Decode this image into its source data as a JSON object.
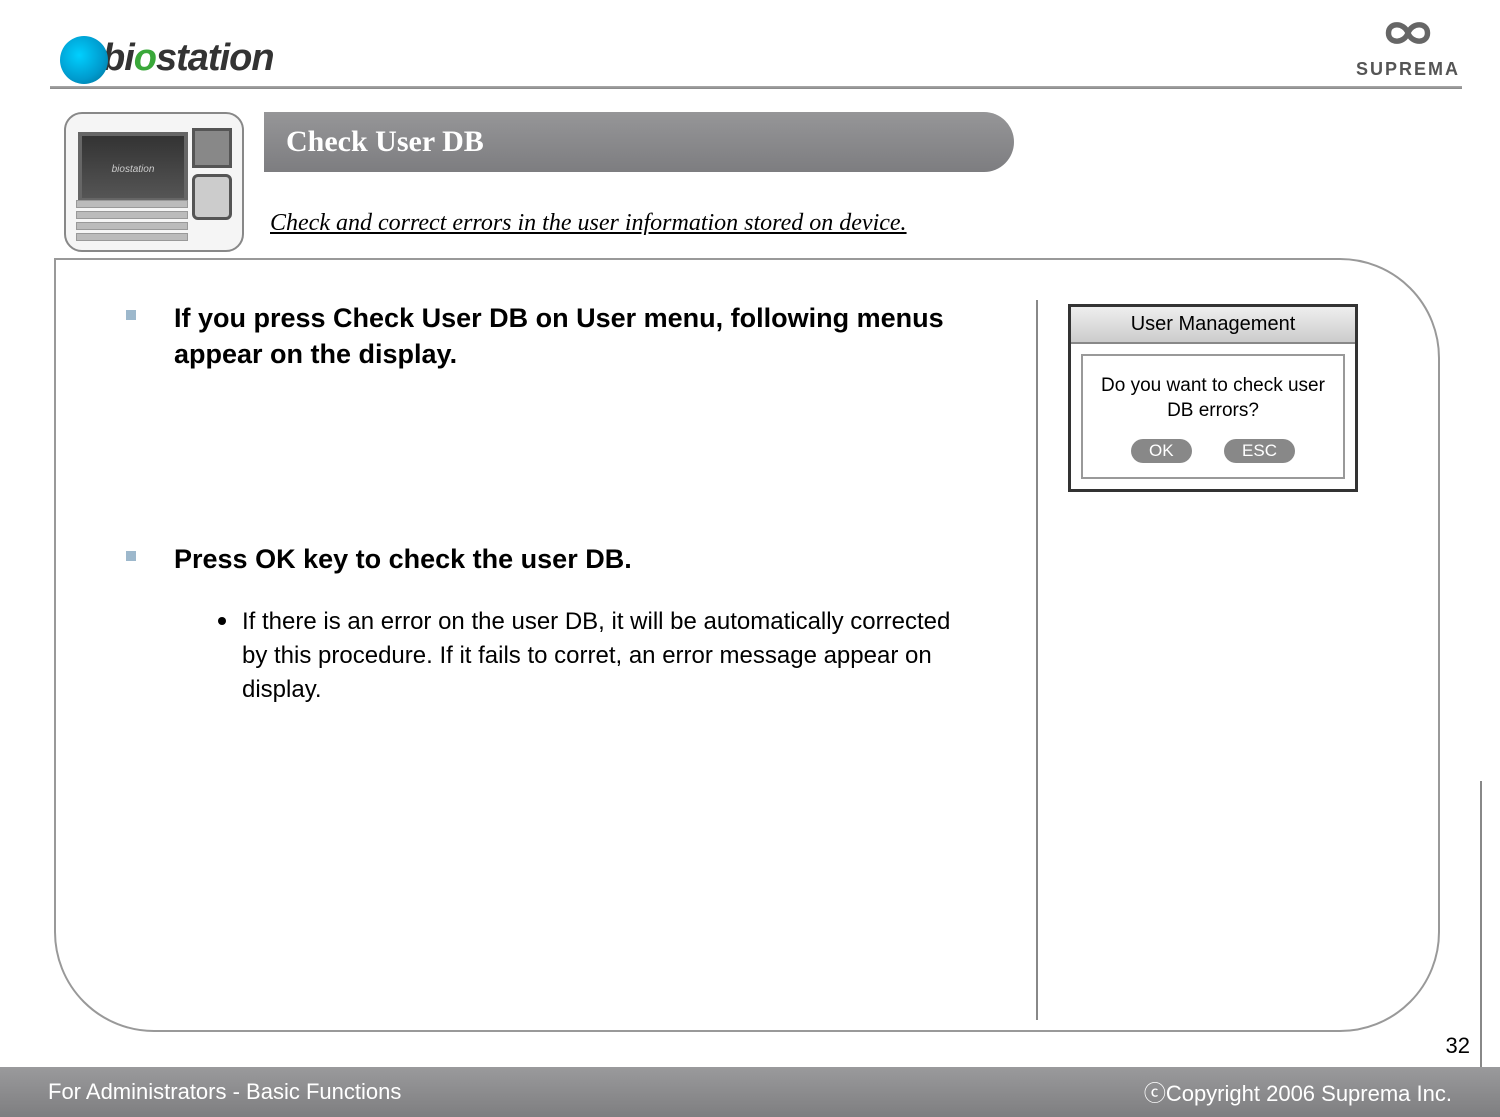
{
  "logo_left": {
    "part1": "bi",
    "part2_green": "o",
    "part3": "station"
  },
  "logo_right": "SUPREMA",
  "title": "Check User DB",
  "subtitle": "Check and correct errors in the user information stored on device.",
  "bullets": [
    {
      "text": "If you press Check User DB on User menu, following menus appear on the display.",
      "subs": []
    },
    {
      "text": "Press OK key to check the user DB.",
      "subs": [
        "If there is an error on the user DB, it will be automatically corrected by this procedure. If it fails to corret, an error message appear on display."
      ]
    }
  ],
  "dialog": {
    "title": "User Management",
    "message": "Do you want to check user DB errors?",
    "ok": "OK",
    "esc": "ESC"
  },
  "footer_left": "For Administrators - Basic Functions",
  "footer_right": "ⓒCopyright 2006 Suprema Inc.",
  "page_number": "32",
  "device_label": "biostation"
}
